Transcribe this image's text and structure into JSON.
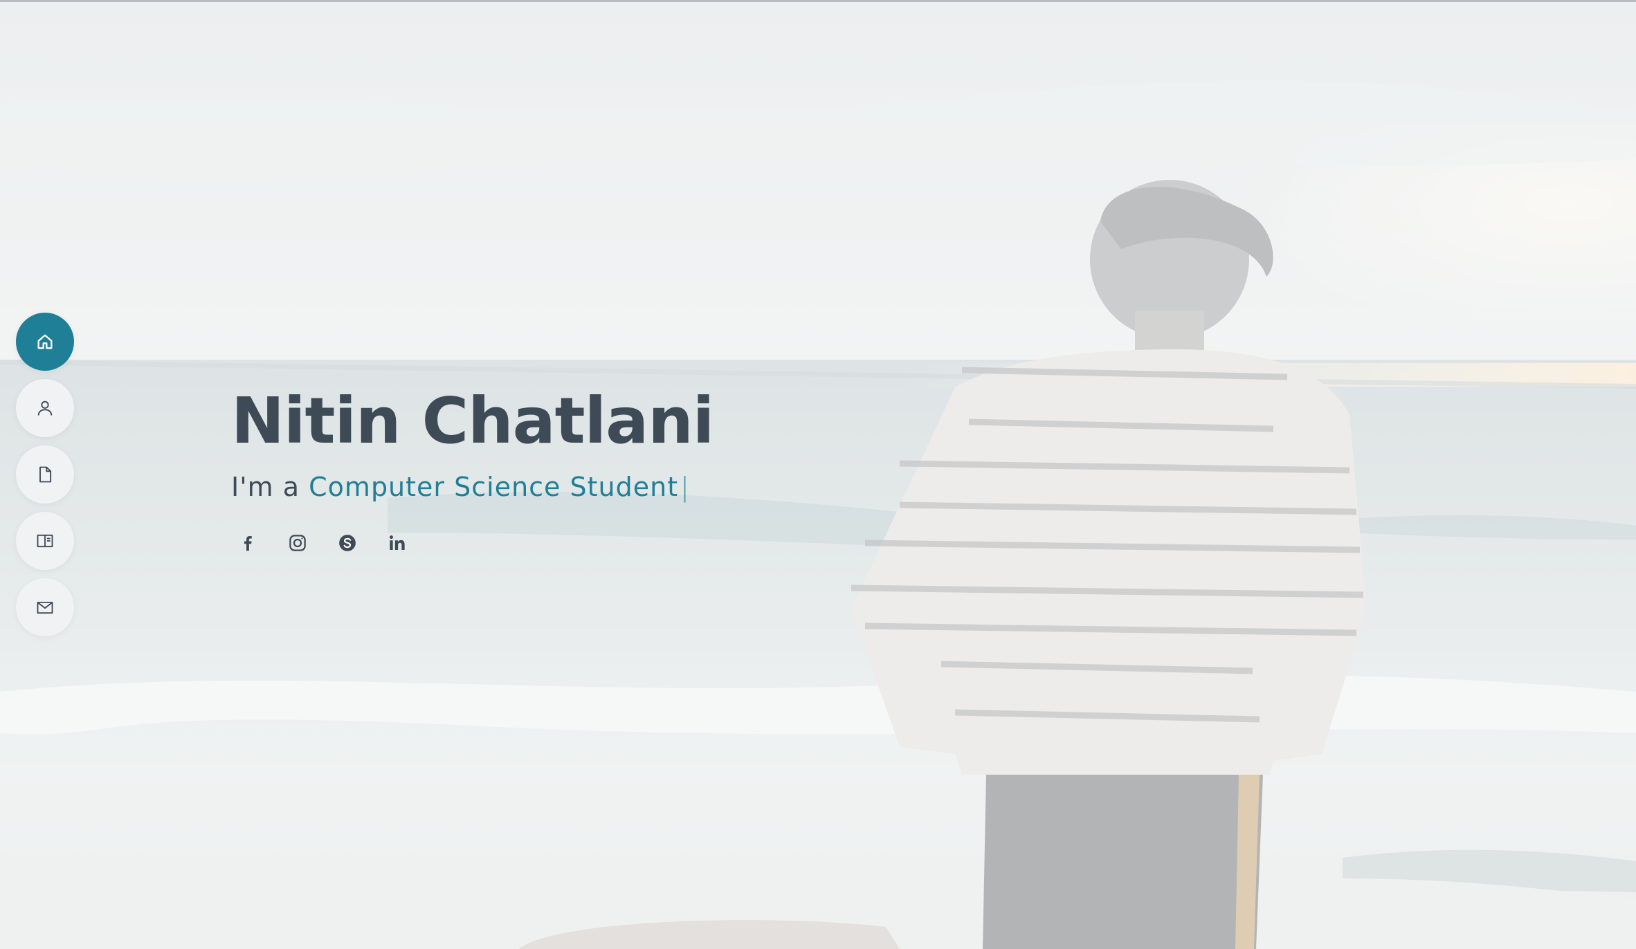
{
  "theme": {
    "accent": "#1f7f97",
    "text": "#3e4a56",
    "nav_bg": "#f1f2f3"
  },
  "side_nav": {
    "items": [
      {
        "icon": "home-icon",
        "active": true
      },
      {
        "icon": "user-icon",
        "active": false
      },
      {
        "icon": "file-icon",
        "active": false
      },
      {
        "icon": "book-icon",
        "active": false
      },
      {
        "icon": "mail-icon",
        "active": false
      }
    ]
  },
  "hero": {
    "name": "Nitin Chatlani",
    "prefix": "I'm a",
    "typed": "Computer Science Student",
    "caret": "|"
  },
  "social": [
    {
      "icon": "facebook-icon"
    },
    {
      "icon": "instagram-icon"
    },
    {
      "icon": "skype-icon"
    },
    {
      "icon": "linkedin-icon"
    }
  ]
}
